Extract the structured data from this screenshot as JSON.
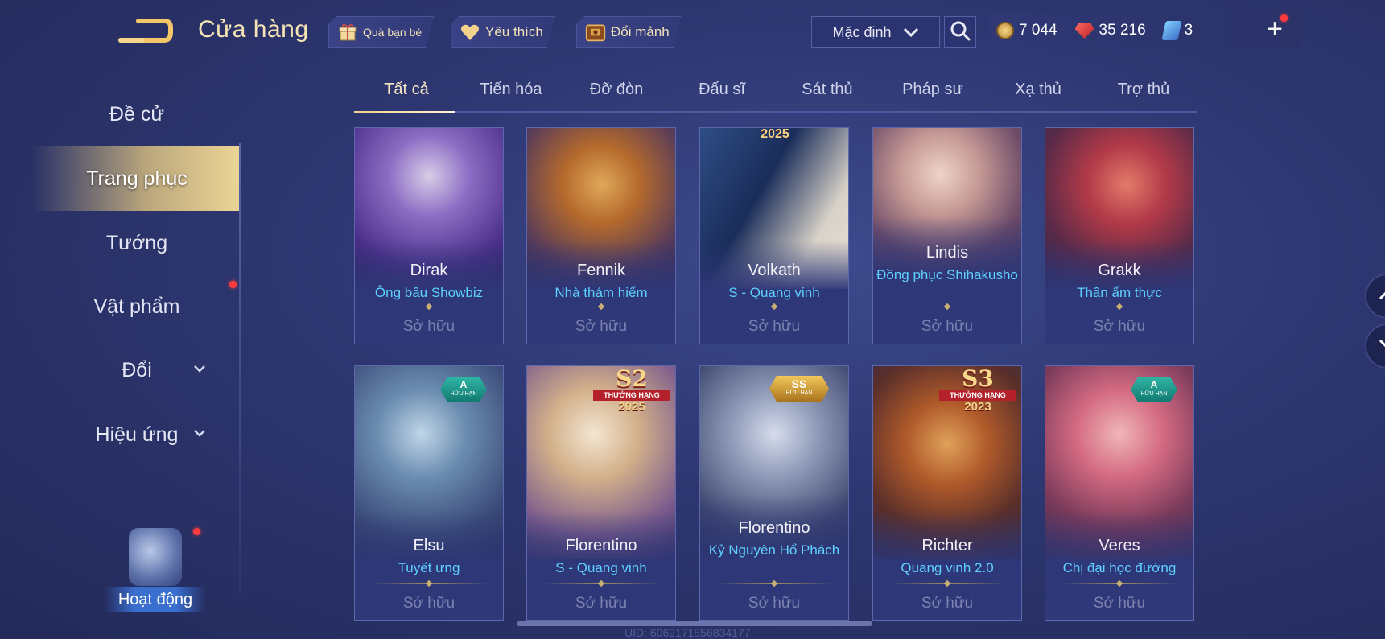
{
  "header": {
    "title": "Cửa hàng",
    "pills": [
      {
        "label": "Quà bạn bè",
        "icon": "gift-icon"
      },
      {
        "label": "Yêu thích",
        "icon": "heart-icon"
      },
      {
        "label": "Đổi mảnh",
        "icon": "chest-icon"
      }
    ],
    "sort": {
      "selected": "Mặc định"
    },
    "currencies": [
      {
        "name": "gold",
        "value": "7 044",
        "icon": "gold-coin-icon"
      },
      {
        "name": "quan-huy",
        "value": "35 216",
        "icon": "red-gem-icon"
      },
      {
        "name": "voucher",
        "value": "3",
        "icon": "voucher-icon"
      }
    ],
    "plus_label": "+"
  },
  "sidebar": {
    "items": [
      {
        "label": "Đề cử"
      },
      {
        "label": "Trang phục"
      },
      {
        "label": "Tướng"
      },
      {
        "label": "Vật phẩm"
      },
      {
        "label": "Đổi"
      },
      {
        "label": "Hiệu ứng"
      }
    ],
    "activity_label": "Hoạt động"
  },
  "tabs": [
    "Tất cả",
    "Tiến hóa",
    "Đỡ đòn",
    "Đấu sĩ",
    "Sát thủ",
    "Pháp sư",
    "Xạ thủ",
    "Trợ thủ"
  ],
  "cards": [
    {
      "hero": "Dirak",
      "skin": "Ông bầu Showbiz",
      "status": "Sở hữu"
    },
    {
      "hero": "Fennik",
      "skin": "Nhà thám hiểm",
      "status": "Sở hữu"
    },
    {
      "hero": "Volkath",
      "skin": "S - Quang vinh",
      "status": "Sở hữu",
      "badge_text": "2025"
    },
    {
      "hero": "Lindis",
      "skin": "Đồng phục Shihakusho",
      "status": "Sở hữu"
    },
    {
      "hero": "Grakk",
      "skin": "Thần ẩm thực",
      "status": "Sở hữu"
    },
    {
      "hero": "Elsu",
      "skin": "Tuyết ưng",
      "status": "Sở hữu",
      "badge_big": "A",
      "badge_sub": "HỮU HẠN"
    },
    {
      "hero": "Florentino",
      "skin": "S - Quang vinh",
      "status": "Sở hữu",
      "badge_big": "S2",
      "badge_sub": "THƯỞNG HẠNG",
      "badge_year": "2025"
    },
    {
      "hero": "Florentino",
      "skin": "Kỷ Nguyên Hổ Phách",
      "status": "Sở hữu",
      "badge_big": "SS",
      "badge_sub": "HỮU HẠN"
    },
    {
      "hero": "Richter",
      "skin": "Quang vinh 2.0",
      "status": "Sở hữu",
      "badge_big": "S3",
      "badge_sub": "THƯỞNG HẠNG",
      "badge_year": "2023"
    },
    {
      "hero": "Veres",
      "skin": "Chị đại học đường",
      "status": "Sở hữu",
      "badge_big": "A",
      "badge_sub": "HỮU HẠN"
    }
  ],
  "footer": {
    "uid": "UID: 6069171856834177"
  },
  "colors": {
    "accent_gold": "#f5e3b5",
    "skin_blue": "#5fd0ff",
    "bg": "#2d3670",
    "notification": "#ff3b3b"
  }
}
